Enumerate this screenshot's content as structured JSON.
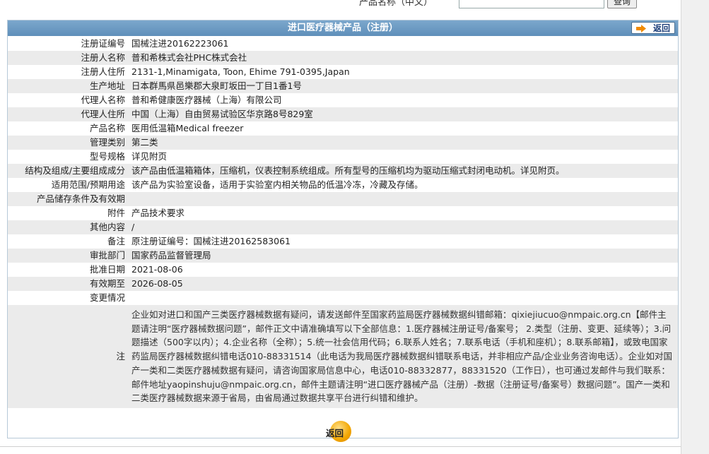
{
  "search": {
    "label": "产品名称（中文）",
    "button": "查询"
  },
  "panel": {
    "title": "进口医疗器械产品（注册）",
    "back_top": "返回",
    "back_bottom": "返回"
  },
  "rows": [
    {
      "label": "注册证编号",
      "value": "国械注进20162223061"
    },
    {
      "label": "注册人名称",
      "value": "普和希株式会社PHC株式会社"
    },
    {
      "label": "注册人住所",
      "value": "2131-1,Minamigata, Toon, Ehime 791-0395,Japan"
    },
    {
      "label": "生产地址",
      "value": "日本群馬県邑樂郡大泉町坂田一丁目1番1号"
    },
    {
      "label": "代理人名称",
      "value": "普和希健康医疗器械（上海）有限公司"
    },
    {
      "label": "代理人住所",
      "value": "中国（上海）自由贸易试验区华京路8号829室"
    },
    {
      "label": "产品名称",
      "value": "医用低温箱Medical freezer"
    },
    {
      "label": "管理类别",
      "value": "第二类"
    },
    {
      "label": "型号规格",
      "value": "详见附页"
    },
    {
      "label": "结构及组成/主要组成成分",
      "value": "该产品由低温箱箱体，压缩机，仪表控制系统组成。所有型号的压缩机均为驱动压缩式封闭电动机。详见附页。"
    },
    {
      "label": "适用范围/预期用途",
      "value": "该产品为实验室设备，适用于实验室内相关物品的低温冷冻，冷藏及存储。"
    },
    {
      "label": "产品储存条件及有效期",
      "value": ""
    },
    {
      "label": "附件",
      "value": "产品技术要求"
    },
    {
      "label": "其他内容",
      "value": "/"
    },
    {
      "label": "备注",
      "value": "原注册证编号：国械注进20162583061"
    },
    {
      "label": "审批部门",
      "value": "国家药品监督管理局"
    },
    {
      "label": "批准日期",
      "value": "2021-08-06"
    },
    {
      "label": "有效期至",
      "value": "2026-08-05"
    },
    {
      "label": "变更情况",
      "value": ""
    }
  ],
  "note": {
    "label": "注",
    "text": "企业如对进口和国产三类医疗器械数据有疑问，请发送邮件至国家药监局医疗器械数据纠错邮箱：qixiejiucuo@nmpaic.org.cn【邮件主题请注明“医疗器械数据问题”，邮件正文中请准确填写以下全部信息：1.医疗器械注册证号/备案号； 2.类型（注册、变更、延续等）；3.问题描述（500字以内）；4.企业名称（全称）；5.统一社会信用代码；6.联系人姓名；7.联系电话（手机和座机）；8.联系邮箱】，或致电国家药监局医疗器械数据纠错电话010-88331514（此电话为我局医疗器械数据纠错联系电话，并非相应产品/企业业务咨询电话）。企业如对国产一类和二类医疗器械数据有疑问，请咨询国家局信息中心，电话010-88332877，88331520（工作日），也可通过发邮件与我们联系：邮件地址yaopinshuju@nmpaic.org.cn，邮件主题请注明“进口医疗器械产品（注册）-数据（注册证号/备案号）数据问题”。国产一类和二类医疗器械数据来源于省局，由省局通过数据共享平台进行纠错和维护。"
  },
  "colors": {
    "title_bar": "#6a98c2",
    "row_alt": "#ebebeb",
    "accent_orange": "#f2a600"
  }
}
